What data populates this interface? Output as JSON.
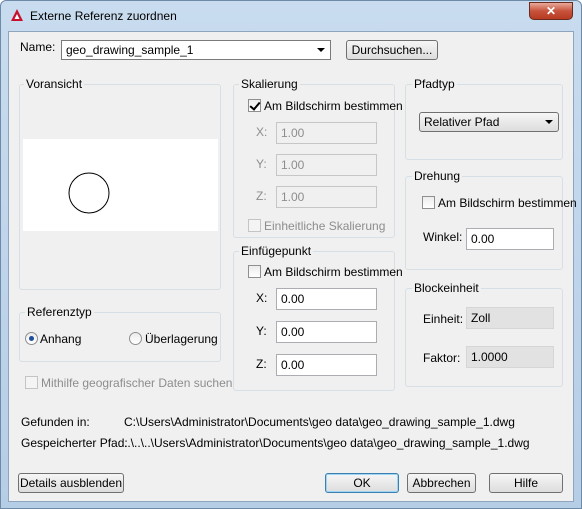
{
  "window": {
    "title": "Externe Referenz zuordnen",
    "close_glyph": "✕"
  },
  "name": {
    "label": "Name:",
    "value": "geo_drawing_sample_1",
    "browse_label": "Durchsuchen..."
  },
  "preview": {
    "legend": "Voransicht"
  },
  "reference_type": {
    "legend": "Referenztyp",
    "attach": "Anhang",
    "overlay": "Überlagerung",
    "selected": "attach"
  },
  "geo_data": {
    "label": "Mithilfe geografischer Daten suchen",
    "checked": false,
    "enabled": false
  },
  "scale": {
    "legend": "Skalierung",
    "on_screen": "Am Bildschirm bestimmen",
    "on_screen_checked": true,
    "x_label": "X:",
    "x": "1.00",
    "y_label": "Y:",
    "y": "1.00",
    "z_label": "Z:",
    "z": "1.00",
    "uniform": "Einheitliche Skalierung",
    "uniform_checked": false
  },
  "insertion": {
    "legend": "Einfügepunkt",
    "on_screen": "Am Bildschirm bestimmen",
    "on_screen_checked": false,
    "x_label": "X:",
    "x": "0.00",
    "y_label": "Y:",
    "y": "0.00",
    "z_label": "Z:",
    "z": "0.00"
  },
  "path_type": {
    "legend": "Pfadtyp",
    "value": "Relativer Pfad"
  },
  "rotation": {
    "legend": "Drehung",
    "on_screen": "Am Bildschirm bestimmen",
    "on_screen_checked": false,
    "angle_label": "Winkel:",
    "angle": "0.00"
  },
  "block_unit": {
    "legend": "Blockeinheit",
    "unit_label": "Einheit:",
    "unit": "Zoll",
    "factor_label": "Faktor:",
    "factor": "1.0000"
  },
  "paths": {
    "found_label": "Gefunden in:",
    "found_value": "C:\\Users\\Administrator\\Documents\\geo data\\geo_drawing_sample_1.dwg",
    "saved_label": "Gespeicherter Pfad:",
    "saved_value": "..\\..\\..\\Users\\Administrator\\Documents\\geo data\\geo_drawing_sample_1.dwg"
  },
  "buttons": {
    "details": "Details ausblenden",
    "ok": "OK",
    "cancel": "Abbrechen",
    "help": "Hilfe"
  },
  "colors": {
    "accent_red": "#c8102e",
    "title_blue": "#b6cde6",
    "radio_dot": "#1f4e9a"
  },
  "icons": {
    "app": "autocad-logo-icon",
    "close": "close-icon",
    "dropdown": "chevron-down-icon"
  }
}
